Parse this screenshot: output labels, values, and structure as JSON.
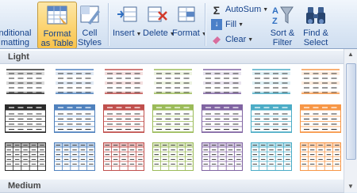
{
  "ribbon": {
    "conditional_formatting": "nditional\nmatting",
    "format_as_table": "Format\nas Table",
    "cell_styles": "Cell\nStyles",
    "insert": "Insert",
    "delete": "Delete",
    "format": "Format",
    "autosum": "AutoSum",
    "fill": "Fill",
    "clear": "Clear",
    "sort_filter": "Sort &\nFilter",
    "find_select": "Find &\nSelect"
  },
  "gallery": {
    "section_light": "Light",
    "section_medium": "Medium"
  },
  "colors": {
    "black": "#2b2b2b",
    "blue": "#4f81bd",
    "red": "#c0504d",
    "green": "#9bbb59",
    "purple": "#8064a2",
    "aqua": "#4bacc6",
    "orange": "#f79646"
  },
  "swatch_colors": [
    "black",
    "blue",
    "red",
    "green",
    "purple",
    "aqua",
    "orange"
  ]
}
